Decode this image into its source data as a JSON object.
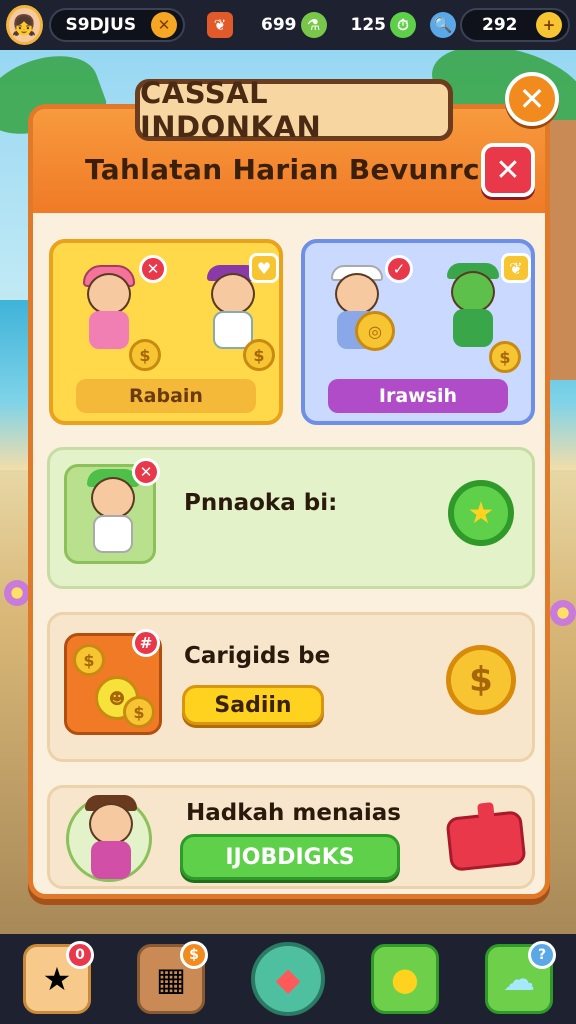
{
  "top_bar": {
    "player_name": "S9DJUS",
    "resource_1": "699",
    "resource_2": "125",
    "resource_3": "292"
  },
  "panel": {
    "title": "CASSAL INDONKAN",
    "subtitle": "Tahlatan Harian Bevunrcas",
    "cards": [
      {
        "label": "Rabain"
      },
      {
        "label": "Irawsih"
      }
    ],
    "rows": [
      {
        "title": "Pnnaoka bi:"
      },
      {
        "title": "Carigids be",
        "button": "Sadiin"
      },
      {
        "title": "Hadkah menaias",
        "button": "IJOBDIGKS"
      }
    ]
  },
  "icons": {
    "close": "close-icon",
    "coin": "coin-icon",
    "star_badge": "star-badge-icon"
  },
  "colors": {
    "panel_border": "#e07a2a",
    "close_red": "#e8384a",
    "button_green": "#5fd04a",
    "button_yellow": "#ffd21f"
  }
}
